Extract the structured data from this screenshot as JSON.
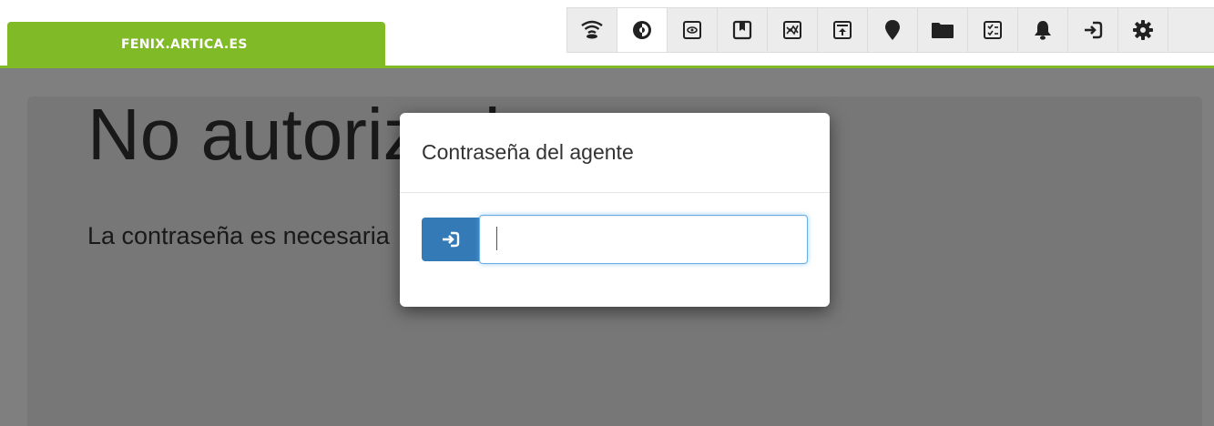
{
  "site": {
    "tab_label": "FENIX.ARTICA.ES",
    "accent_color": "#80ba27"
  },
  "toolbar": {
    "items": [
      {
        "icon": "wifi-signal-icon",
        "active": false
      },
      {
        "icon": "eye-contrast-icon",
        "active": true
      },
      {
        "icon": "eye-box-icon",
        "active": false
      },
      {
        "icon": "bookmark-box-icon",
        "active": false
      },
      {
        "icon": "chart-box-icon",
        "active": false
      },
      {
        "icon": "upload-box-icon",
        "active": false
      },
      {
        "icon": "map-marker-icon",
        "active": false
      },
      {
        "icon": "folder-icon",
        "active": false
      },
      {
        "icon": "checklist-icon",
        "active": false
      },
      {
        "icon": "bell-icon",
        "active": false
      },
      {
        "icon": "logout-icon",
        "active": false
      },
      {
        "icon": "gear-icon",
        "active": false
      }
    ]
  },
  "main": {
    "title": "No autorizado",
    "message": "La contraseña es necesaria"
  },
  "modal": {
    "title": "Contraseña del agente",
    "submit_icon": "login-icon",
    "submit_color": "#337ab7",
    "password_value": "",
    "password_placeholder": ""
  }
}
